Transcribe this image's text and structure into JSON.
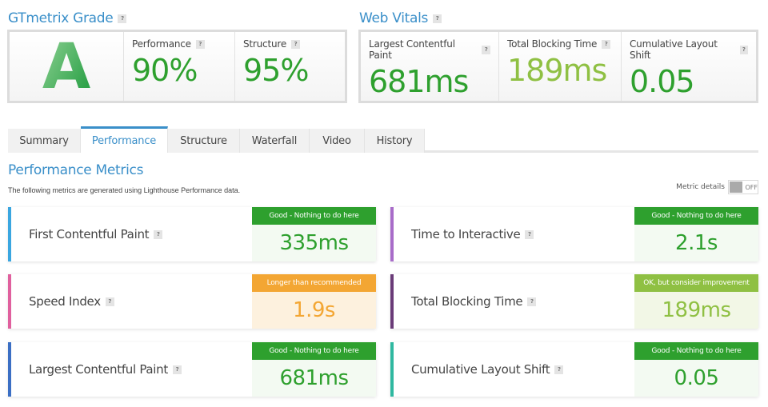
{
  "grade": {
    "title": "GTmetrix Grade",
    "help": "?",
    "letter": "A",
    "items": [
      {
        "label": "Performance",
        "help": "?",
        "value": "90%"
      },
      {
        "label": "Structure",
        "help": "?",
        "value": "95%"
      }
    ]
  },
  "vitals": {
    "title": "Web Vitals",
    "help": "?",
    "items": [
      {
        "label": "Largest Contentful Paint",
        "help": "?",
        "value": "681ms",
        "color": "#2ea02e"
      },
      {
        "label": "Total Blocking Time",
        "help": "?",
        "value": "189ms",
        "color": "#8fc043"
      },
      {
        "label": "Cumulative Layout Shift",
        "help": "?",
        "value": "0.05",
        "color": "#2ea02e"
      }
    ]
  },
  "tabs": [
    {
      "label": "Summary",
      "active": false
    },
    {
      "label": "Performance",
      "active": true
    },
    {
      "label": "Structure",
      "active": false
    },
    {
      "label": "Waterfall",
      "active": false
    },
    {
      "label": "Video",
      "active": false
    },
    {
      "label": "History",
      "active": false
    }
  ],
  "performance": {
    "title": "Performance Metrics",
    "description": "The following metrics are generated using Lighthouse Performance data.",
    "toggle": {
      "label": "Metric details",
      "state": "OFF"
    },
    "metrics": [
      {
        "name": "First Contentful Paint",
        "help": "?",
        "status": "Good - Nothing to do here",
        "value": "335ms",
        "bar_color": "#3aa6e0",
        "status_color": "#2ea02e",
        "value_color": "#2ea02e",
        "value_bg": "#f3faf2"
      },
      {
        "name": "Time to Interactive",
        "help": "?",
        "status": "Good - Nothing to do here",
        "value": "2.1s",
        "bar_color": "#a86cc9",
        "status_color": "#2ea02e",
        "value_color": "#2ea02e",
        "value_bg": "#f3faf2"
      },
      {
        "name": "Speed Index",
        "help": "?",
        "status": "Longer than recommended",
        "value": "1.9s",
        "bar_color": "#e0609e",
        "status_color": "#f3a633",
        "value_color": "#f3a633",
        "value_bg": "#fdf1de"
      },
      {
        "name": "Total Blocking Time",
        "help": "?",
        "status": "OK, but consider improvement",
        "value": "189ms",
        "bar_color": "#6a3b78",
        "status_color": "#8fc043",
        "value_color": "#8fc043",
        "value_bg": "#f2f7e6"
      },
      {
        "name": "Largest Contentful Paint",
        "help": "?",
        "status": "Good - Nothing to do here",
        "value": "681ms",
        "bar_color": "#3b6fc4",
        "status_color": "#2ea02e",
        "value_color": "#2ea02e",
        "value_bg": "#f3faf2"
      },
      {
        "name": "Cumulative Layout Shift",
        "help": "?",
        "status": "Good - Nothing to do here",
        "value": "0.05",
        "bar_color": "#2fb8a0",
        "status_color": "#2ea02e",
        "value_color": "#2ea02e",
        "value_bg": "#f3faf2"
      }
    ]
  }
}
